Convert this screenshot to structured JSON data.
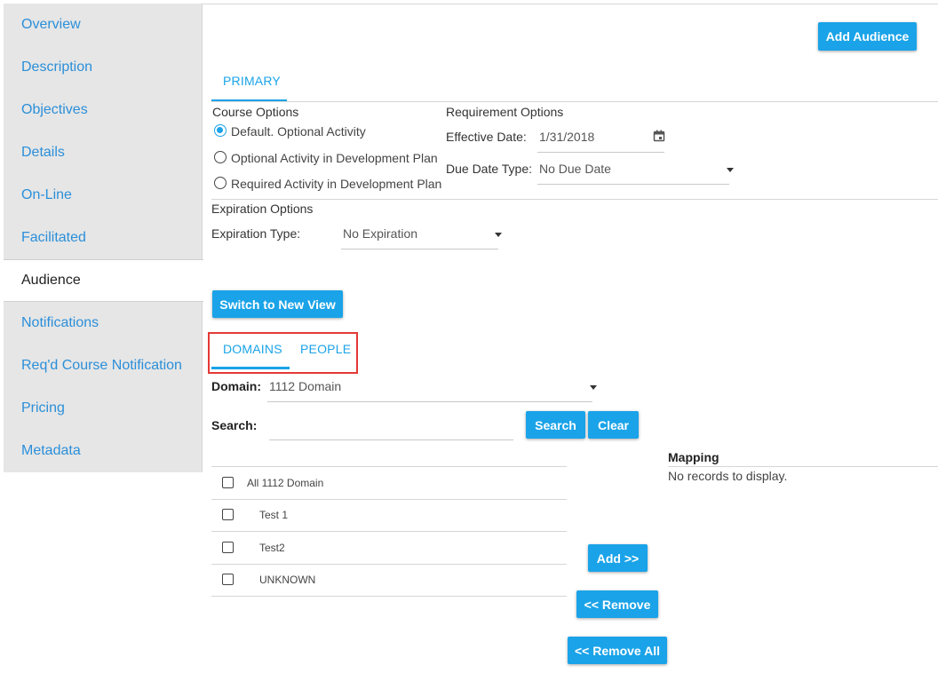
{
  "sidebar": {
    "items": [
      {
        "label": "Overview"
      },
      {
        "label": "Description"
      },
      {
        "label": "Objectives"
      },
      {
        "label": "Details"
      },
      {
        "label": "On-Line"
      },
      {
        "label": "Facilitated"
      },
      {
        "label": "Audience"
      },
      {
        "label": "Notifications"
      },
      {
        "label": "Req'd Course Notification"
      },
      {
        "label": "Pricing"
      },
      {
        "label": "Metadata"
      }
    ],
    "active": "Audience"
  },
  "header": {
    "add_audience_label": "Add Audience"
  },
  "primary_tab": {
    "label": "PRIMARY"
  },
  "course_options": {
    "title": "Course Options",
    "options": [
      {
        "label": "Default. Optional Activity",
        "checked": true
      },
      {
        "label": "Optional Activity in Development Plan",
        "checked": false
      },
      {
        "label": "Required Activity in Development Plan",
        "checked": false
      }
    ]
  },
  "requirement_options": {
    "title": "Requirement Options",
    "effective_date_label": "Effective Date:",
    "effective_date_value": "1/31/2018",
    "due_date_type_label": "Due Date Type:",
    "due_date_type_value": "No Due Date"
  },
  "expiration_options": {
    "title": "Expiration Options",
    "type_label": "Expiration Type:",
    "type_value": "No Expiration"
  },
  "switch_view_label": "Switch to New View",
  "sub_tabs": [
    {
      "label": "DOMAINS",
      "active": true
    },
    {
      "label": "PEOPLE",
      "active": false
    }
  ],
  "domain": {
    "label": "Domain:",
    "value": "1112 Domain"
  },
  "search": {
    "label": "Search:",
    "value": "",
    "search_button": "Search",
    "clear_button": "Clear"
  },
  "domain_list": [
    {
      "label": "All 1112 Domain",
      "checked": false
    },
    {
      "label": "Test 1",
      "checked": false
    },
    {
      "label": "Test2",
      "checked": false
    },
    {
      "label": "UNKNOWN",
      "checked": false
    }
  ],
  "actions": {
    "add": "Add >>",
    "remove": "<< Remove",
    "remove_all": "<< Remove All"
  },
  "mapping": {
    "title": "Mapping",
    "empty_text": "No records to display."
  },
  "colors": {
    "accent": "#1aa3e8",
    "highlight_box": "#e53935",
    "sidebar_bg": "#e6e6e6"
  }
}
